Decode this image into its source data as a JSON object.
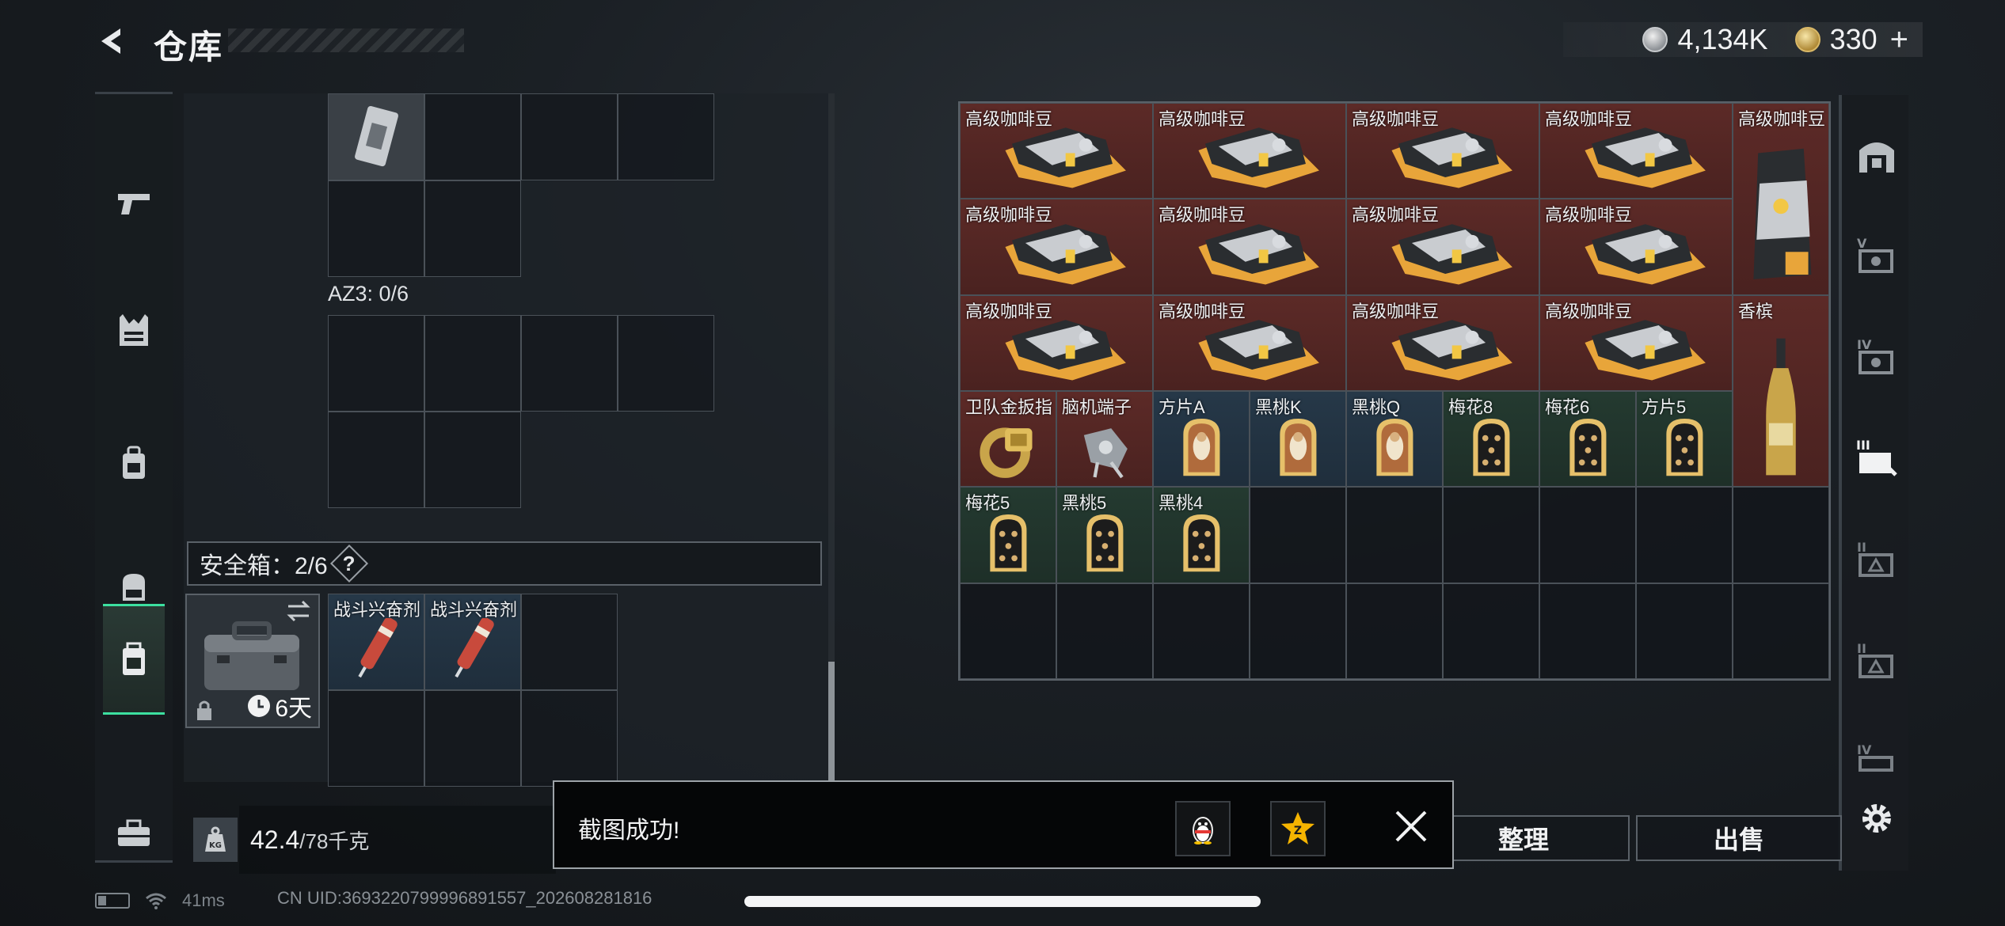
{
  "header": {
    "title": "仓库"
  },
  "currency": {
    "silver_amount": "4,134K",
    "gold_amount": "330",
    "plus_label": "+"
  },
  "left_sidebar": {
    "items": [
      "pistol-icon",
      "armor-vest-icon",
      "backpack-icon",
      "bag-icon",
      "safe-box-icon",
      "toolbox-icon"
    ],
    "active_index": 4
  },
  "left_panel": {
    "az3_label": "AZ3: 0/6",
    "safe_box": {
      "title": "安全箱：2/6",
      "help": "?",
      "days": "6天"
    },
    "safe_items": [
      {
        "name": "战斗兴奋剂"
      },
      {
        "name": "战斗兴奋剂"
      }
    ],
    "weight": {
      "current": "42.4",
      "max": "/78千克"
    }
  },
  "storage": {
    "columns": 9,
    "rows": 6,
    "items": [
      {
        "name": "高级咖啡豆",
        "row": 0,
        "col": 0,
        "w": 2,
        "h": 1,
        "rarity": "red",
        "type": "coffee"
      },
      {
        "name": "高级咖啡豆",
        "row": 0,
        "col": 2,
        "w": 2,
        "h": 1,
        "rarity": "red",
        "type": "coffee"
      },
      {
        "name": "高级咖啡豆",
        "row": 0,
        "col": 4,
        "w": 2,
        "h": 1,
        "rarity": "red",
        "type": "coffee"
      },
      {
        "name": "高级咖啡豆",
        "row": 0,
        "col": 6,
        "w": 2,
        "h": 1,
        "rarity": "red",
        "type": "coffee"
      },
      {
        "name": "高级咖啡豆",
        "row": 0,
        "col": 8,
        "w": 1,
        "h": 2,
        "rarity": "red",
        "type": "coffee-bag"
      },
      {
        "name": "高级咖啡豆",
        "row": 1,
        "col": 0,
        "w": 2,
        "h": 1,
        "rarity": "red",
        "type": "coffee"
      },
      {
        "name": "高级咖啡豆",
        "row": 1,
        "col": 2,
        "w": 2,
        "h": 1,
        "rarity": "red",
        "type": "coffee"
      },
      {
        "name": "高级咖啡豆",
        "row": 1,
        "col": 4,
        "w": 2,
        "h": 1,
        "rarity": "red",
        "type": "coffee"
      },
      {
        "name": "高级咖啡豆",
        "row": 1,
        "col": 6,
        "w": 2,
        "h": 1,
        "rarity": "red",
        "type": "coffee"
      },
      {
        "name": "高级咖啡豆",
        "row": 2,
        "col": 0,
        "w": 2,
        "h": 1,
        "rarity": "red",
        "type": "coffee"
      },
      {
        "name": "高级咖啡豆",
        "row": 2,
        "col": 2,
        "w": 2,
        "h": 1,
        "rarity": "red",
        "type": "coffee"
      },
      {
        "name": "高级咖啡豆",
        "row": 2,
        "col": 4,
        "w": 2,
        "h": 1,
        "rarity": "red",
        "type": "coffee"
      },
      {
        "name": "高级咖啡豆",
        "row": 2,
        "col": 6,
        "w": 2,
        "h": 1,
        "rarity": "red",
        "type": "coffee"
      },
      {
        "name": "香槟",
        "row": 2,
        "col": 8,
        "w": 1,
        "h": 2,
        "rarity": "red",
        "type": "champagne"
      },
      {
        "name": "卫队金扳指",
        "row": 3,
        "col": 0,
        "w": 1,
        "h": 1,
        "rarity": "red",
        "type": "ring"
      },
      {
        "name": "脑机端子",
        "row": 3,
        "col": 1,
        "w": 1,
        "h": 1,
        "rarity": "red",
        "type": "device"
      },
      {
        "name": "方片A",
        "row": 3,
        "col": 2,
        "w": 1,
        "h": 1,
        "rarity": "blue",
        "type": "card-face"
      },
      {
        "name": "黑桃K",
        "row": 3,
        "col": 3,
        "w": 1,
        "h": 1,
        "rarity": "blue",
        "type": "card-face"
      },
      {
        "name": "黑桃Q",
        "row": 3,
        "col": 4,
        "w": 1,
        "h": 1,
        "rarity": "blue",
        "type": "card-face"
      },
      {
        "name": "梅花8",
        "row": 3,
        "col": 5,
        "w": 1,
        "h": 1,
        "rarity": "green",
        "type": "card"
      },
      {
        "name": "梅花6",
        "row": 3,
        "col": 6,
        "w": 1,
        "h": 1,
        "rarity": "green",
        "type": "card"
      },
      {
        "name": "方片5",
        "row": 3,
        "col": 7,
        "w": 1,
        "h": 1,
        "rarity": "green",
        "type": "card"
      },
      {
        "name": "梅花5",
        "row": 4,
        "col": 0,
        "w": 1,
        "h": 1,
        "rarity": "green",
        "type": "card"
      },
      {
        "name": "黑桃5",
        "row": 4,
        "col": 1,
        "w": 1,
        "h": 1,
        "rarity": "green",
        "type": "card"
      },
      {
        "name": "黑桃4",
        "row": 4,
        "col": 2,
        "w": 1,
        "h": 1,
        "rarity": "green",
        "type": "card"
      }
    ]
  },
  "right_sidebar": {
    "items": [
      "storage-arch-icon",
      "storage-v-icon",
      "storage-iv-icon",
      "storage-iii-icon",
      "storage-ii-icon",
      "storage-ii-b-icon",
      "storage-iv-b-icon"
    ],
    "labels": [
      "",
      "V",
      "IV",
      "III",
      "II",
      "II",
      "IV"
    ],
    "active_index": 3
  },
  "actions": {
    "sort": "整理",
    "sell": "出售"
  },
  "toast": {
    "message": "截图成功!"
  },
  "status_bar": {
    "ping": "41ms",
    "uid": "CN UID:3693220799996891557_202608281816"
  },
  "colors": {
    "accent": "#3ce0a0",
    "rarity_red": "#5c2a27",
    "rarity_blue": "#263848",
    "rarity_green": "#243a30"
  }
}
